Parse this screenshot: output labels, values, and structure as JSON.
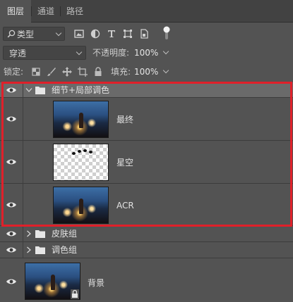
{
  "tabs": [
    {
      "label": "图层",
      "active": true
    },
    {
      "label": "通道",
      "active": false
    },
    {
      "label": "路径",
      "active": false
    }
  ],
  "filter": {
    "kind_label": "类型",
    "icons": [
      "image-filter-icon",
      "adjustment-filter-icon",
      "type-filter-icon",
      "shape-filter-icon",
      "smart-object-filter-icon",
      "filter-toggle-icon"
    ]
  },
  "blend": {
    "mode": "穿透",
    "opacity_label": "不透明度:",
    "opacity_value": "100%"
  },
  "lock": {
    "label": "锁定:",
    "icons": [
      "lock-transparent-icon",
      "lock-image-icon",
      "lock-position-icon",
      "lock-artboard-icon",
      "lock-all-icon"
    ],
    "fill_label": "填充:",
    "fill_value": "100%"
  },
  "layers": [
    {
      "name": "细节+局部调色",
      "type": "group",
      "expanded": true
    },
    {
      "name": "最终",
      "type": "photo"
    },
    {
      "name": "星空",
      "type": "transparent"
    },
    {
      "name": "ACR",
      "type": "photo"
    },
    {
      "name": "皮肤组",
      "type": "group",
      "expanded": false
    },
    {
      "name": "调色组",
      "type": "group",
      "expanded": false
    },
    {
      "name": "背景",
      "type": "background"
    }
  ],
  "colors": {
    "panel": "#535353",
    "tab_bar": "#424242",
    "highlight_border": "#e0202a",
    "selected_group": "#6a6a6a"
  }
}
